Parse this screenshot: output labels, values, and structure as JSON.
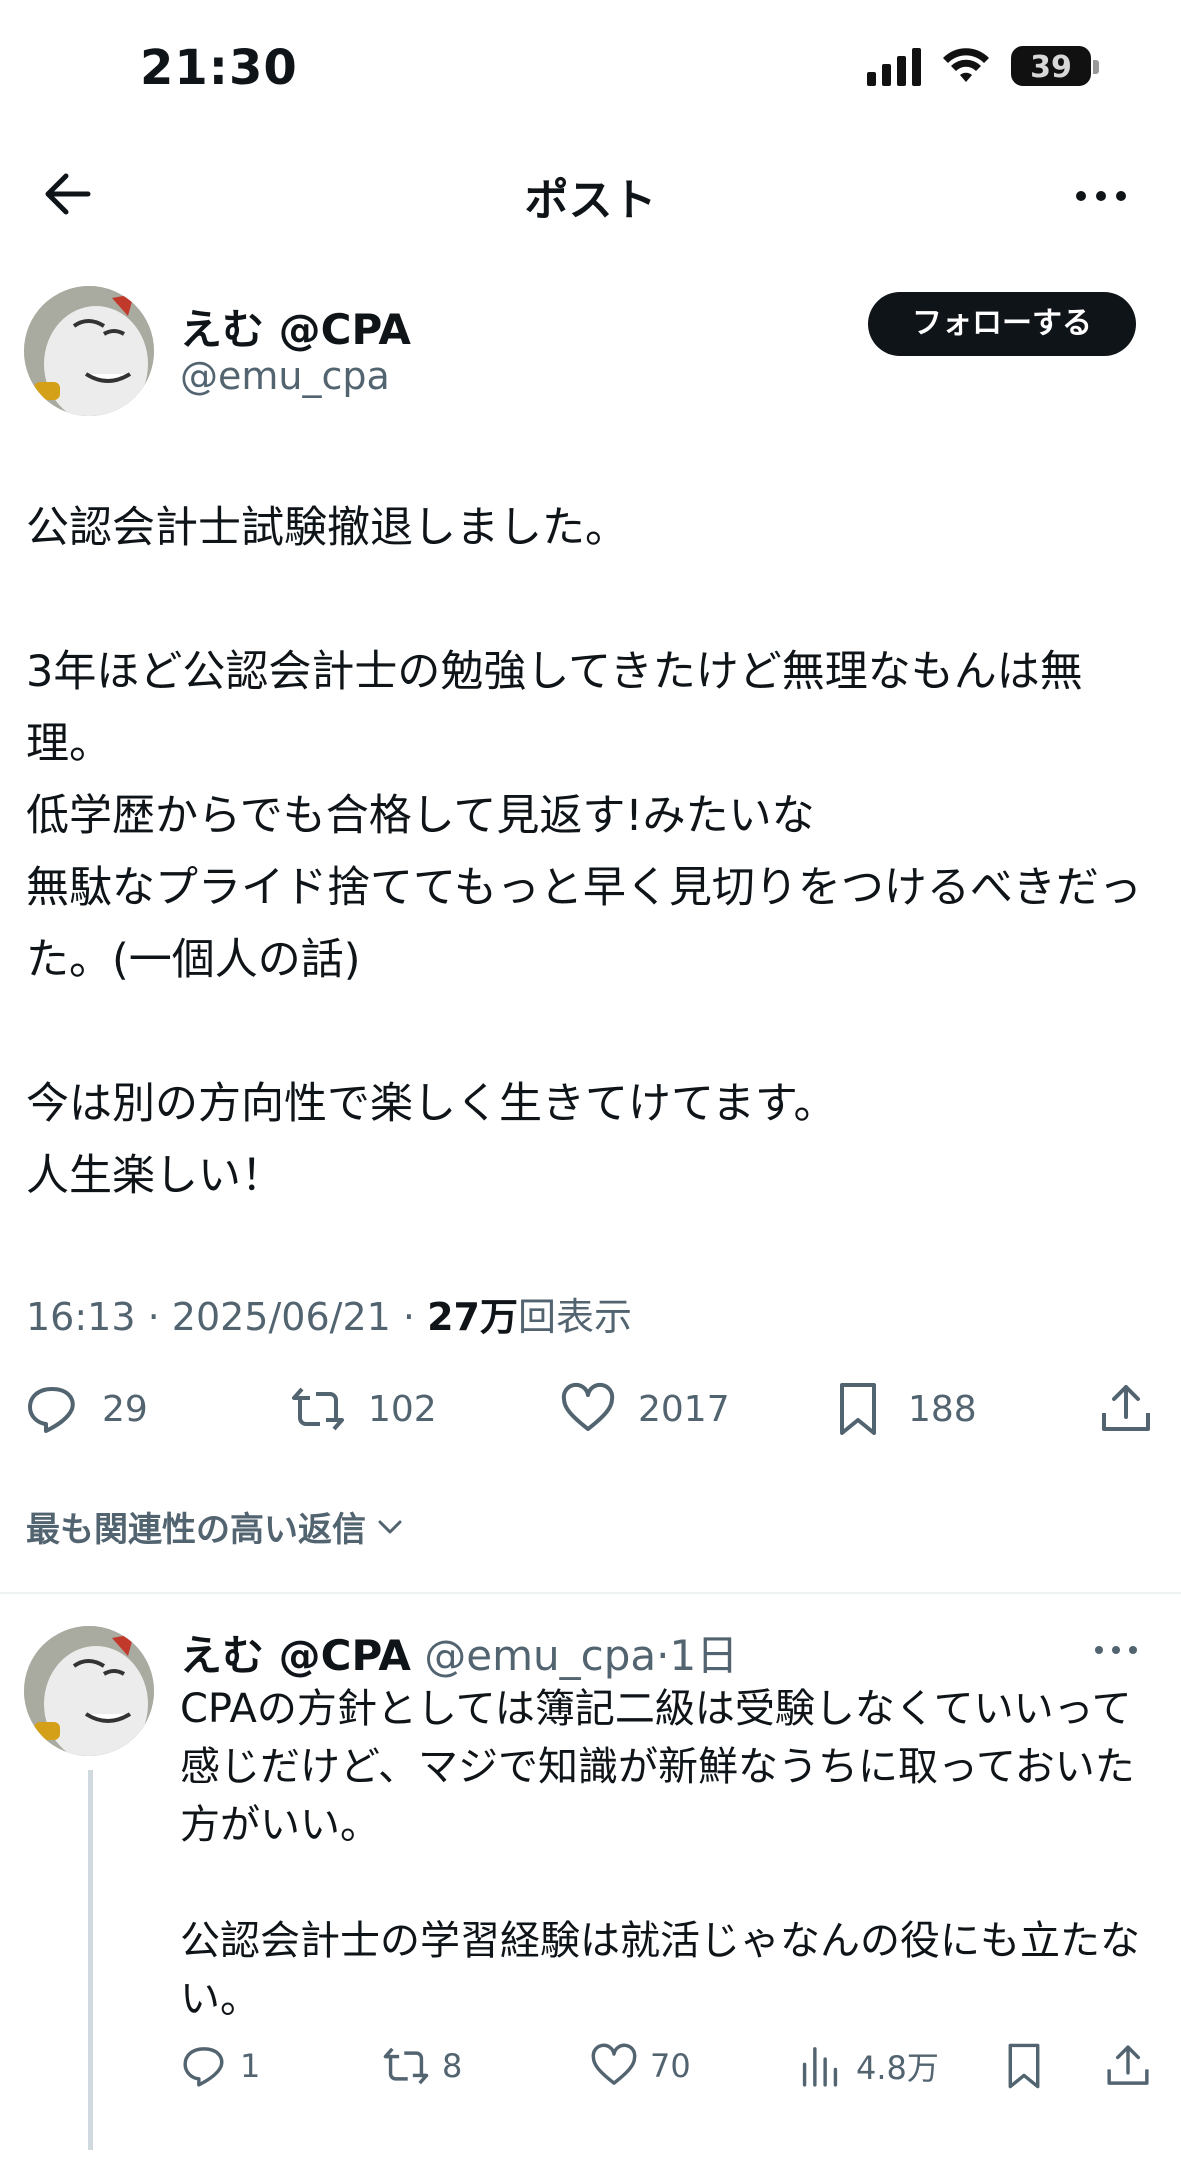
{
  "status_bar": {
    "time": "21:30",
    "battery": "39",
    "icons": [
      "signal-icon",
      "wifi-icon",
      "battery-icon"
    ]
  },
  "nav": {
    "title": "ポスト",
    "icons": [
      "back-arrow-icon",
      "more-icon"
    ]
  },
  "post": {
    "author_name": "えむ @CPA",
    "author_handle": "@emu_cpa",
    "follow_label": "フォローする",
    "body": "公認会計士試験撤退しました。\n\n3年ほど公認会計士の勉強してきたけど無理なもんは無理。\n低学歴からでも合格して見返す!みたいな\n無駄なプライド捨ててもっと早く見切りをつけるべきだった。(一個人の話)\n\n今は別の方向性で楽しく生きてけてます。\n人生楽しい！",
    "time": "16:13",
    "date": "2025/06/21",
    "views_count": "27万",
    "views_label": "回表示",
    "stats": {
      "replies": "29",
      "reposts": "102",
      "likes": "2017",
      "bookmarks": "188"
    }
  },
  "replies_sort_label": "最も関連性の高い返信",
  "reply": {
    "author_name": "えむ @CPA",
    "author_handle": "@emu_cpa",
    "age": "1日",
    "body": "CPAの方針としては簿記二級は受験しなくていいって感じだけど、マジで知識が新鮮なうちに取っておいた方がいい。\n\n公認会計士の学習経験は就活じゃなんの役にも立たない。",
    "stats": {
      "replies": "1",
      "reposts": "8",
      "likes": "70",
      "views": "4.8万"
    }
  },
  "colors": {
    "text": "#0f1419",
    "secondary": "#536471",
    "divider": "#eff3f4",
    "thread_line": "#cfd9de",
    "button_bg": "#0f1419"
  }
}
